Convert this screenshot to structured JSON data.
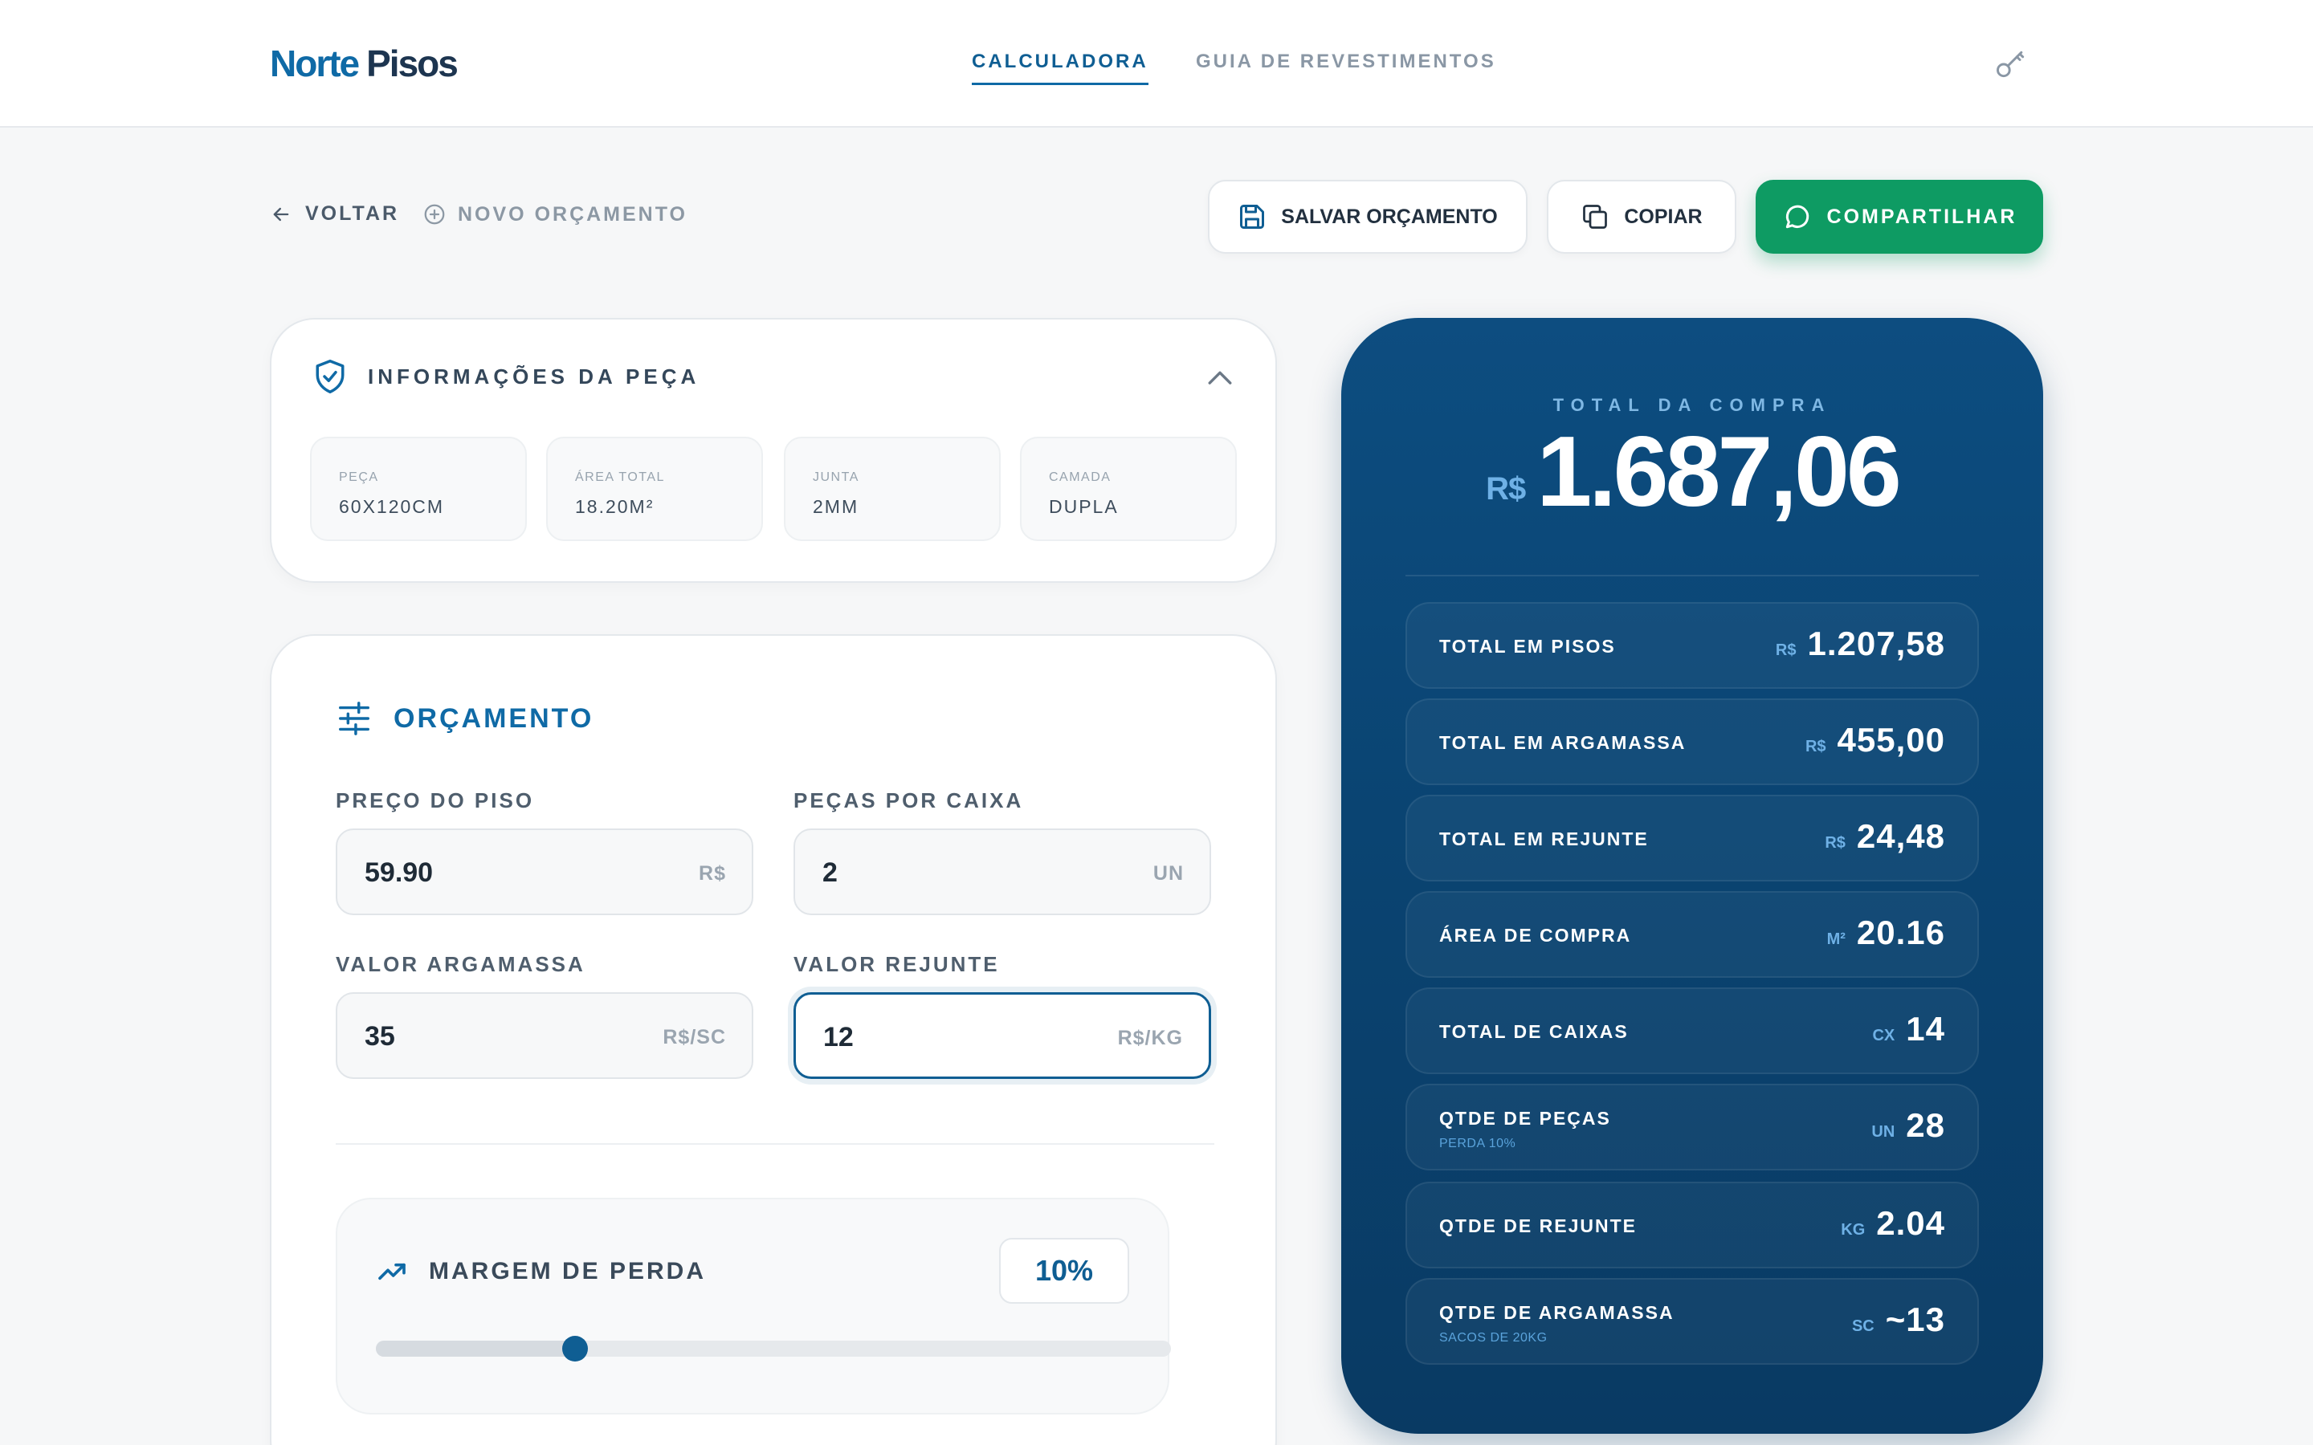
{
  "header": {
    "logo_part1": "Norte",
    "logo_part2": "Pisos",
    "nav_calculadora": "CALCULADORA",
    "nav_guia": "GUIA DE REVESTIMENTOS",
    "accent": "#0f6aa6"
  },
  "toolbar": {
    "back_label": "VOLTAR",
    "new_label": "NOVO ORÇAMENTO",
    "save_label": "SALVAR ORÇAMENTO",
    "copy_label": "COPIAR",
    "share_label": "COMPARTILHAR",
    "share_color": "#0e9b63"
  },
  "info": {
    "title": "INFORMAÇÕES DA PEÇA",
    "items": [
      {
        "label": "PEÇA",
        "value": "60X120CM"
      },
      {
        "label": "ÁREA TOTAL",
        "value": "18.20M²"
      },
      {
        "label": "JUNTA",
        "value": "2MM"
      },
      {
        "label": "CAMADA",
        "value": "DUPLA"
      }
    ]
  },
  "budget": {
    "title": "ORÇAMENTO",
    "fields": [
      {
        "label": "PREÇO DO PISO",
        "value": "59.90",
        "unit": "R$"
      },
      {
        "label": "PEÇAS POR CAIXA",
        "value": "2",
        "unit": "UN"
      },
      {
        "label": "VALOR ARGAMASSA",
        "value": "35",
        "unit": "R$/SC"
      },
      {
        "label": "VALOR REJUNTE",
        "value": "12",
        "unit": "R$/KG"
      }
    ],
    "loss": {
      "title": "MARGEM DE PERDA",
      "display": "10%",
      "fraction": 0.25
    }
  },
  "summary": {
    "caption": "TOTAL DA COMPRA",
    "currency": "R$",
    "total": "1.687,06",
    "rows": [
      {
        "label": "TOTAL EM PISOS",
        "unit": "R$",
        "value": "1.207,58",
        "sub": ""
      },
      {
        "label": "TOTAL EM ARGAMASSA",
        "unit": "R$",
        "value": "455,00",
        "sub": ""
      },
      {
        "label": "TOTAL EM REJUNTE",
        "unit": "R$",
        "value": "24,48",
        "sub": ""
      },
      {
        "label": "ÁREA DE COMPRA",
        "unit": "M²",
        "value": "20.16",
        "sub": ""
      },
      {
        "label": "TOTAL DE CAIXAS",
        "unit": "CX",
        "value": "14",
        "sub": ""
      },
      {
        "label": "QTDE DE PEÇAS",
        "unit": "UN",
        "value": "28",
        "sub": "PERDA 10%"
      },
      {
        "label": "QTDE DE REJUNTE",
        "unit": "KG",
        "value": "2.04",
        "sub": ""
      },
      {
        "label": "QTDE DE ARGAMASSA",
        "unit": "SC",
        "value": "~13",
        "sub": "SACOS DE 20KG"
      }
    ],
    "panel_color": "#0a4472"
  },
  "icons": {
    "key": "key-icon",
    "back": "arrow-left-icon",
    "new": "plus-circle-icon",
    "save": "floppy-disk-icon",
    "copy": "copy-icon",
    "share": "whatsapp-chat-icon",
    "shield": "shield-check-icon",
    "collapse": "chevron-up-icon",
    "sliders": "sliders-icon",
    "trend": "trending-up-icon"
  }
}
